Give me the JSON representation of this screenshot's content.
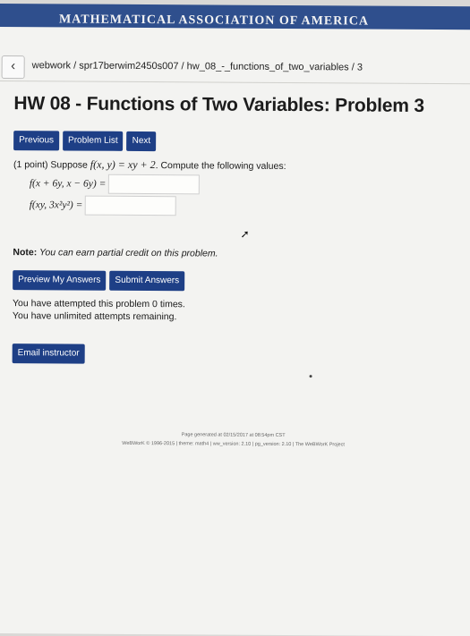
{
  "banner": {
    "text": "MATHEMATICAL ASSOCIATION OF AMERICA"
  },
  "breadcrumb": "webwork / spr17berwim2450s007 / hw_08_-_functions_of_two_variables / 3",
  "title": "HW 08 - Functions of Two Variables: Problem 3",
  "nav": {
    "previous": "Previous",
    "problem_list": "Problem List",
    "next": "Next"
  },
  "problem": {
    "points": "(1 point)",
    "suppose": "Suppose",
    "function": "f(x, y) = xy + 2",
    "instruction": ". Compute the following values:",
    "q1": {
      "label": "f(x + 6y, x − 6y) =",
      "value": ""
    },
    "q2": {
      "label": "f(xy, 3x²y²) =",
      "value": ""
    }
  },
  "note": {
    "label": "Note:",
    "text": " You can earn partial credit on this problem."
  },
  "actions": {
    "preview": "Preview My Answers",
    "submit": "Submit Answers"
  },
  "attempts": {
    "line1": "You have attempted this problem 0 times.",
    "line2": "You have unlimited attempts remaining."
  },
  "email": "Email instructor",
  "footer": {
    "generated": "Page generated at 02/15/2017 at 08:54pm CST",
    "credits": "WeBWorK © 1996-2015 | theme: math4 | ww_version: 2.10 | pg_version: 2.10 | The WeBWorK Project"
  },
  "colors": {
    "button": "#1e3f86",
    "banner": "#2f4f8d",
    "page": "#f3f3f1"
  },
  "icons": {
    "back": "chevron-left-icon",
    "cursor": "cursor-arrow-icon"
  }
}
